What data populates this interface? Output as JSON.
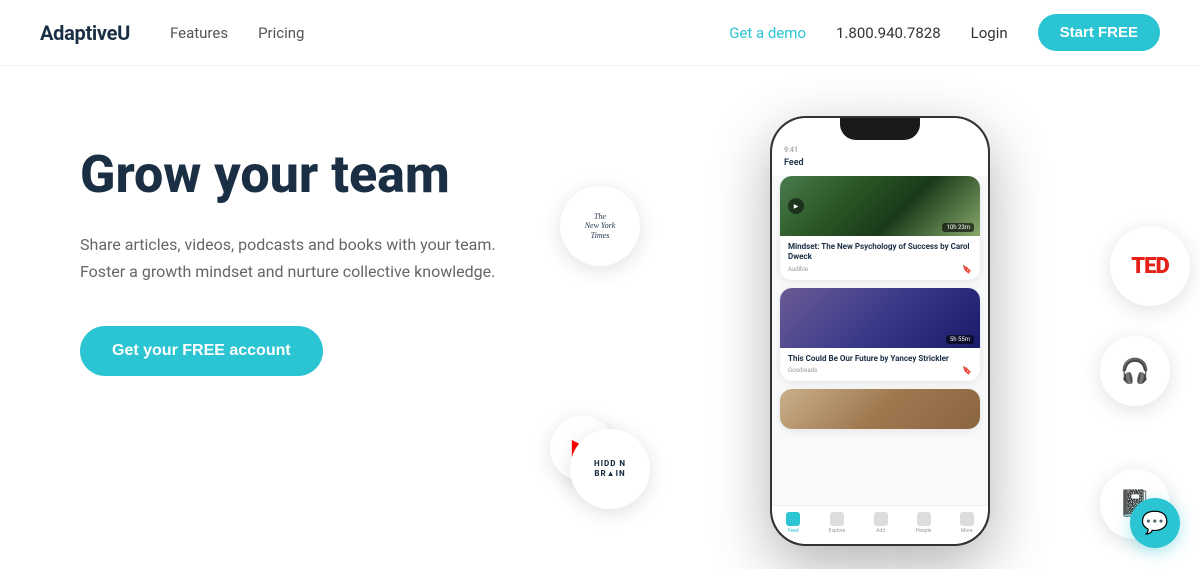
{
  "nav": {
    "logo": "AdaptiveU",
    "links": [
      {
        "label": "Features",
        "id": "features"
      },
      {
        "label": "Pricing",
        "id": "pricing"
      }
    ],
    "demo": "Get a demo",
    "phone": "1.800.940.7828",
    "login": "Login",
    "start_free": "Start FREE"
  },
  "hero": {
    "title": "Grow your team",
    "subtitle_line1": "Share articles, videos, podcasts and books with your team.",
    "subtitle_line2": "Foster a growth mindset and nurture collective knowledge.",
    "cta": "Get your FREE account"
  },
  "phone": {
    "card1": {
      "title": "Mindset: The New Psychology of Success by Carol Dweck",
      "source": "Audible",
      "duration": "10h 23m"
    },
    "card2": {
      "title": "This Could Be Our Future by Yancey Strickler",
      "source": "Goodreads",
      "duration": "5h 55m"
    }
  },
  "brands": {
    "nyt": "The\nNew York\nTimes",
    "ted": "TED",
    "audible": "🎧",
    "youtube": "▶",
    "hidden_brain": "HIDD N\nBR IN",
    "book": "📓"
  },
  "chat": {
    "icon": "💬"
  }
}
